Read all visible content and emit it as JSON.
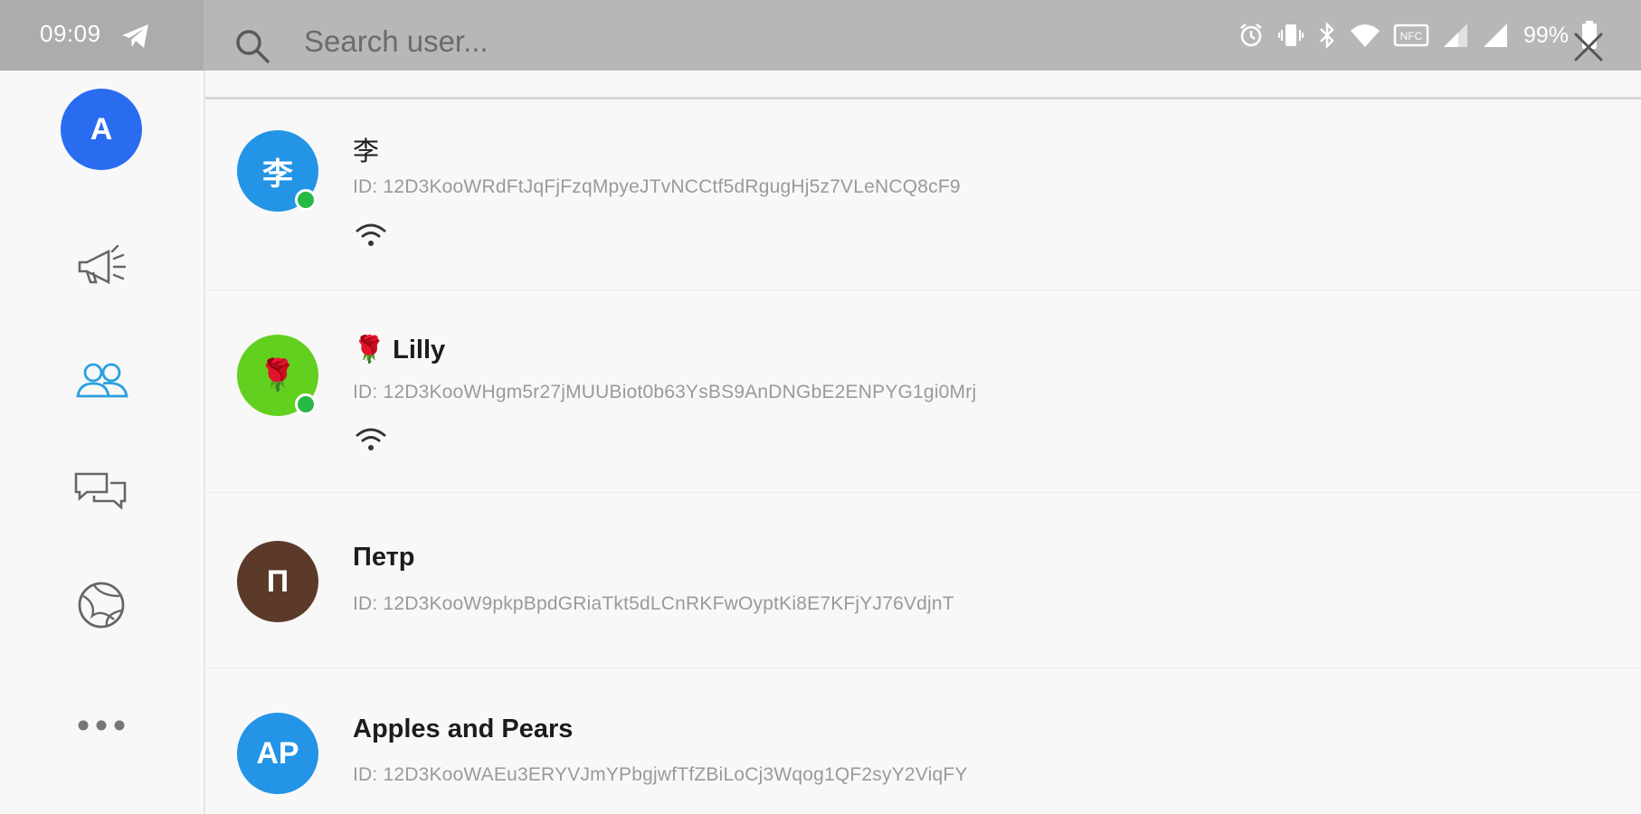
{
  "status_bar": {
    "time": "09:09",
    "battery_percent": "99%",
    "icons": [
      "telegram-icon",
      "alarm-icon",
      "vibrate-icon",
      "bluetooth-icon",
      "wifi-icon",
      "nfc-icon",
      "signal-icon",
      "signal-icon",
      "battery-icon"
    ]
  },
  "search": {
    "placeholder": "Search user...",
    "value": ""
  },
  "sidebar": {
    "profile_initial": "A",
    "profile_color": "#2a6cf0",
    "accent_color": "#2aa0e0",
    "items": [
      {
        "icon": "megaphone-icon",
        "active": false
      },
      {
        "icon": "users-icon",
        "active": true
      },
      {
        "icon": "chat-icon",
        "active": false
      },
      {
        "icon": "globe-icon",
        "active": false
      },
      {
        "icon": "more-icon",
        "active": false
      }
    ]
  },
  "users": [
    {
      "avatar_text": "李",
      "avatar_color": "#2394e6",
      "online": true,
      "name": "李",
      "id_text": "ID: 12D3KooWRdFtJqFjFzqMpyeJTvNCCtf5dRgugHj5z7VLeNCQ8cF9",
      "connection": "wifi-icon"
    },
    {
      "avatar_text": "🌹",
      "avatar_color": "#62d01f",
      "online": true,
      "name": "🌹 Lilly",
      "id_text": "ID: 12D3KooWHgm5r27jMUUBiot0b63YsBS9AnDNGbE2ENPYG1gi0Mrj",
      "connection": "wifi-icon"
    },
    {
      "avatar_text": "П",
      "avatar_color": "#5b3a2a",
      "online": false,
      "name": "Петр",
      "id_text": "ID: 12D3KooW9pkpBpdGRiaTkt5dLCnRKFwOyptKi8E7KFjYJ76VdjnT",
      "connection": ""
    },
    {
      "avatar_text": "AP",
      "avatar_color": "#2394e6",
      "online": false,
      "name": "Apples and Pears",
      "id_text": "ID: 12D3KooWAEu3ERYVJmYPbgjwfTfZBiLoCj3Wqog1QF2syY2ViqFY",
      "connection": ""
    }
  ]
}
